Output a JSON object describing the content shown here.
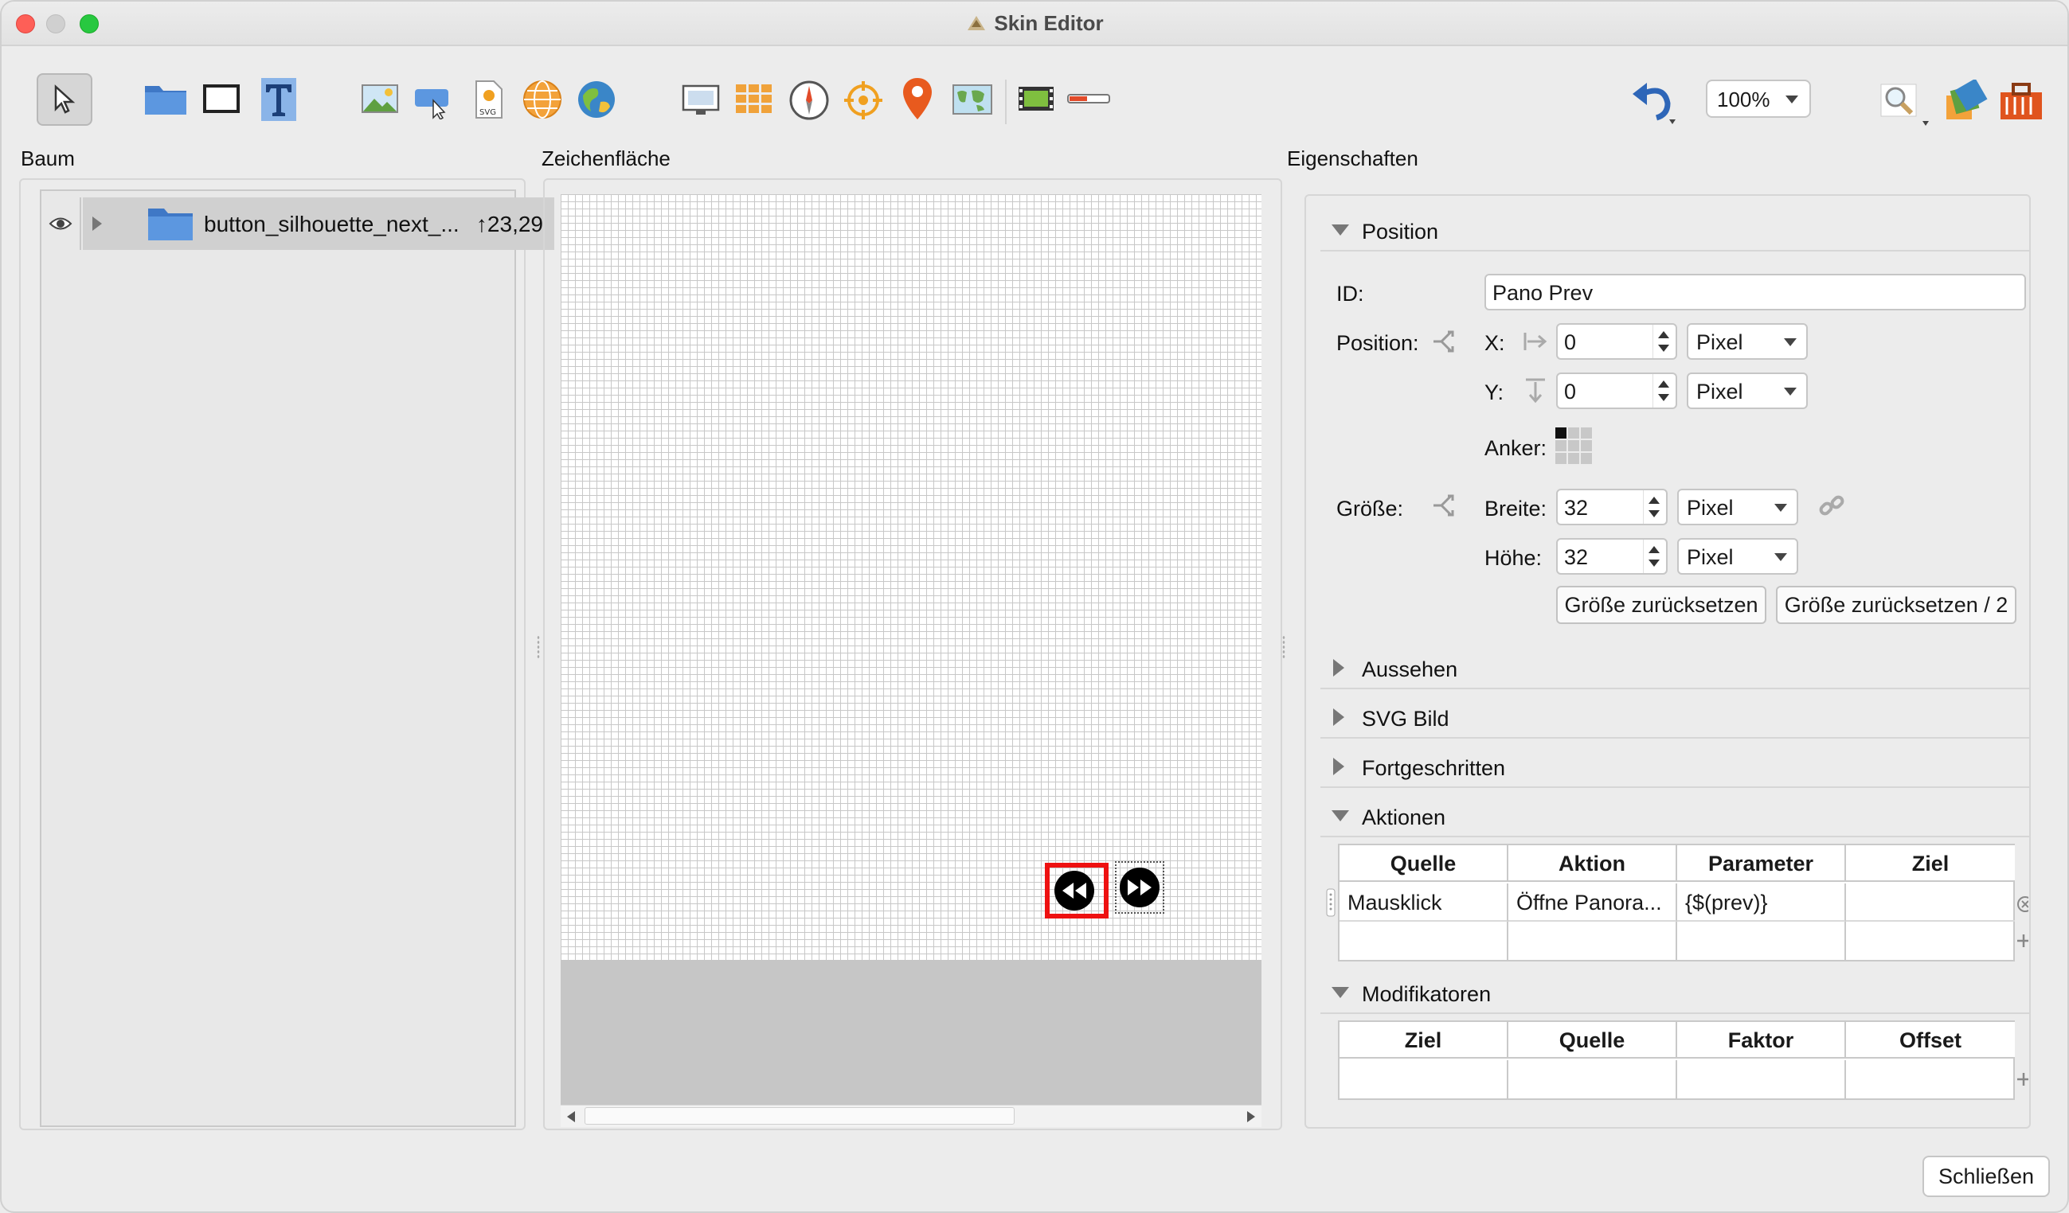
{
  "window": {
    "title": "Skin Editor"
  },
  "toolbar": {
    "zoom_value": "100%",
    "tools": [
      "pointer-tool",
      "container-tool",
      "rectangle-tool",
      "text-tool",
      "image-tool",
      "button-tool",
      "svg-tool",
      "panorama-tool",
      "map-tool",
      "screen-tool",
      "grid-tool",
      "compass-tool",
      "hotspot-tool",
      "pin-tool",
      "map-view-tool",
      "video-tool",
      "slider-tool",
      "undo-tool",
      "zoom-menu",
      "search-tool",
      "palette-tool",
      "toolbox-tool"
    ],
    "svg_icon_text": "SVG"
  },
  "panels": {
    "tree_label": "Baum",
    "canvas_label": "Zeichenfläche",
    "properties_label": "Eigenschaften"
  },
  "tree": {
    "items": [
      {
        "label": "button_silhouette_next_...",
        "coord": "↑23,29"
      }
    ]
  },
  "properties": {
    "position_section": {
      "title": "Position",
      "id_label": "ID:",
      "id_value": "Pano Prev",
      "position_label": "Position:",
      "x_label": "X:",
      "x_value": "0",
      "x_unit": "Pixel",
      "y_label": "Y:",
      "y_value": "0",
      "y_unit": "Pixel",
      "anchor_label": "Anker:",
      "size_label": "Größe:",
      "width_label": "Breite:",
      "width_value": "32",
      "width_unit": "Pixel",
      "height_label": "Höhe:",
      "height_value": "32",
      "height_unit": "Pixel",
      "reset_size_button": "Größe zurücksetzen",
      "reset_size_half_button": "Größe zurücksetzen / 2"
    },
    "collapsed_sections": [
      "Aussehen",
      "SVG Bild",
      "Fortgeschritten"
    ],
    "actions_section": {
      "title": "Aktionen",
      "columns": [
        "Quelle",
        "Aktion",
        "Parameter",
        "Ziel"
      ],
      "rows": [
        [
          "Mausklick",
          "Öffne Panora...",
          "{$(prev)}",
          ""
        ]
      ]
    },
    "modifiers_section": {
      "title": "Modifikatoren",
      "columns": [
        "Ziel",
        "Quelle",
        "Faktor",
        "Offset"
      ],
      "rows": []
    }
  },
  "footer": {
    "close_button": "Schließen"
  },
  "colors": {
    "selection_outline": "#ee1111",
    "folder_blue": "#4a8ad4",
    "window_bg": "#ececec"
  }
}
